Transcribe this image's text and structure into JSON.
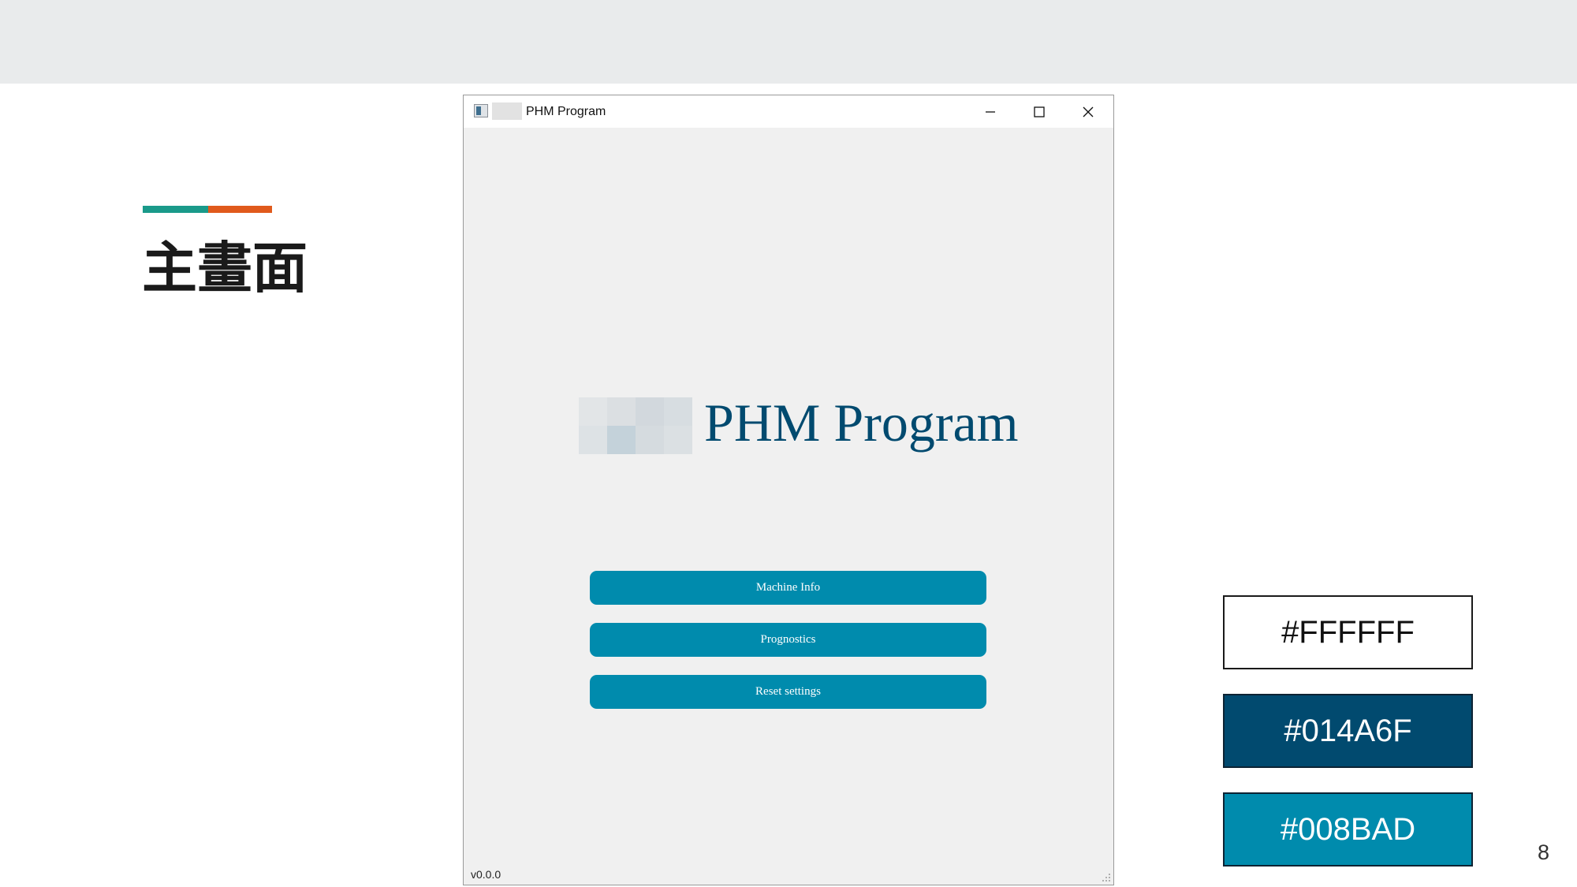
{
  "slide": {
    "title": "主畫面",
    "page_number": "8",
    "accent_colors": [
      "#1a9a8a",
      "#e05a1c"
    ]
  },
  "window": {
    "title": "PHM Program",
    "controls": [
      "minimize-icon",
      "maximize-icon",
      "close-icon"
    ]
  },
  "app": {
    "heading": "PHM Program",
    "heading_color": "#014a6f",
    "buttons": [
      {
        "label": "Machine Info"
      },
      {
        "label": "Prognostics"
      },
      {
        "label": "Reset settings"
      }
    ],
    "button_color": "#008bad",
    "version": "v0.0.0",
    "logo_mosaic": [
      "#e2e5e7",
      "#dbdfe2",
      "#d2d8dd",
      "#d7dde1",
      "#dde2e5",
      "#c4d2da",
      "#d5dbdf",
      "#dbe0e3"
    ]
  },
  "swatches": [
    {
      "label": "#FFFFFF",
      "color": "#FFFFFF"
    },
    {
      "label": "#014A6F",
      "color": "#014A6F"
    },
    {
      "label": "#008BAD",
      "color": "#008BAD"
    }
  ]
}
